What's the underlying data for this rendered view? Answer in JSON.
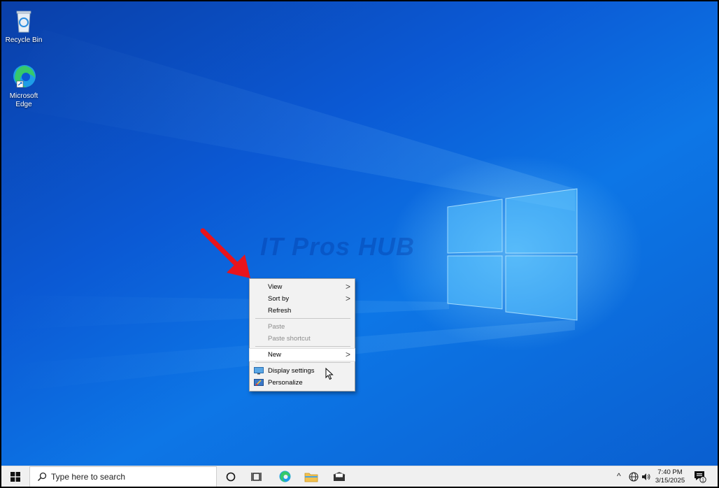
{
  "desktop": {
    "icons": [
      {
        "label": "Recycle Bin"
      },
      {
        "label": "Microsoft Edge"
      }
    ],
    "watermark": "IT Pros HUB"
  },
  "context_menu": {
    "items": [
      {
        "label": "View",
        "submenu": true,
        "disabled": false
      },
      {
        "label": "Sort by",
        "submenu": true,
        "disabled": false
      },
      {
        "label": "Refresh",
        "submenu": false,
        "disabled": false
      },
      {
        "label": "Paste",
        "submenu": false,
        "disabled": true
      },
      {
        "label": "Paste shortcut",
        "submenu": false,
        "disabled": true
      },
      {
        "label": "New",
        "submenu": true,
        "disabled": false
      },
      {
        "label": "Display settings",
        "icon": "display-icon",
        "disabled": false
      },
      {
        "label": "Personalize",
        "icon": "personalize-icon",
        "disabled": false
      }
    ],
    "submenu_chevron": ">"
  },
  "taskbar": {
    "search_placeholder": "Type here to search",
    "pinned": [
      "cortana-icon",
      "task-view-icon",
      "edge-icon",
      "file-explorer-icon",
      "mail-icon"
    ],
    "tray": {
      "chevron": "^",
      "time": "7:40 PM",
      "date": "3/15/2025",
      "notification_count": "1"
    }
  },
  "colors": {
    "desktop_blue": "#0b59d4",
    "menu_bg": "#f2f2f2",
    "taskbar_bg": "#f0f0f0",
    "arrow_red": "#e8141c"
  }
}
